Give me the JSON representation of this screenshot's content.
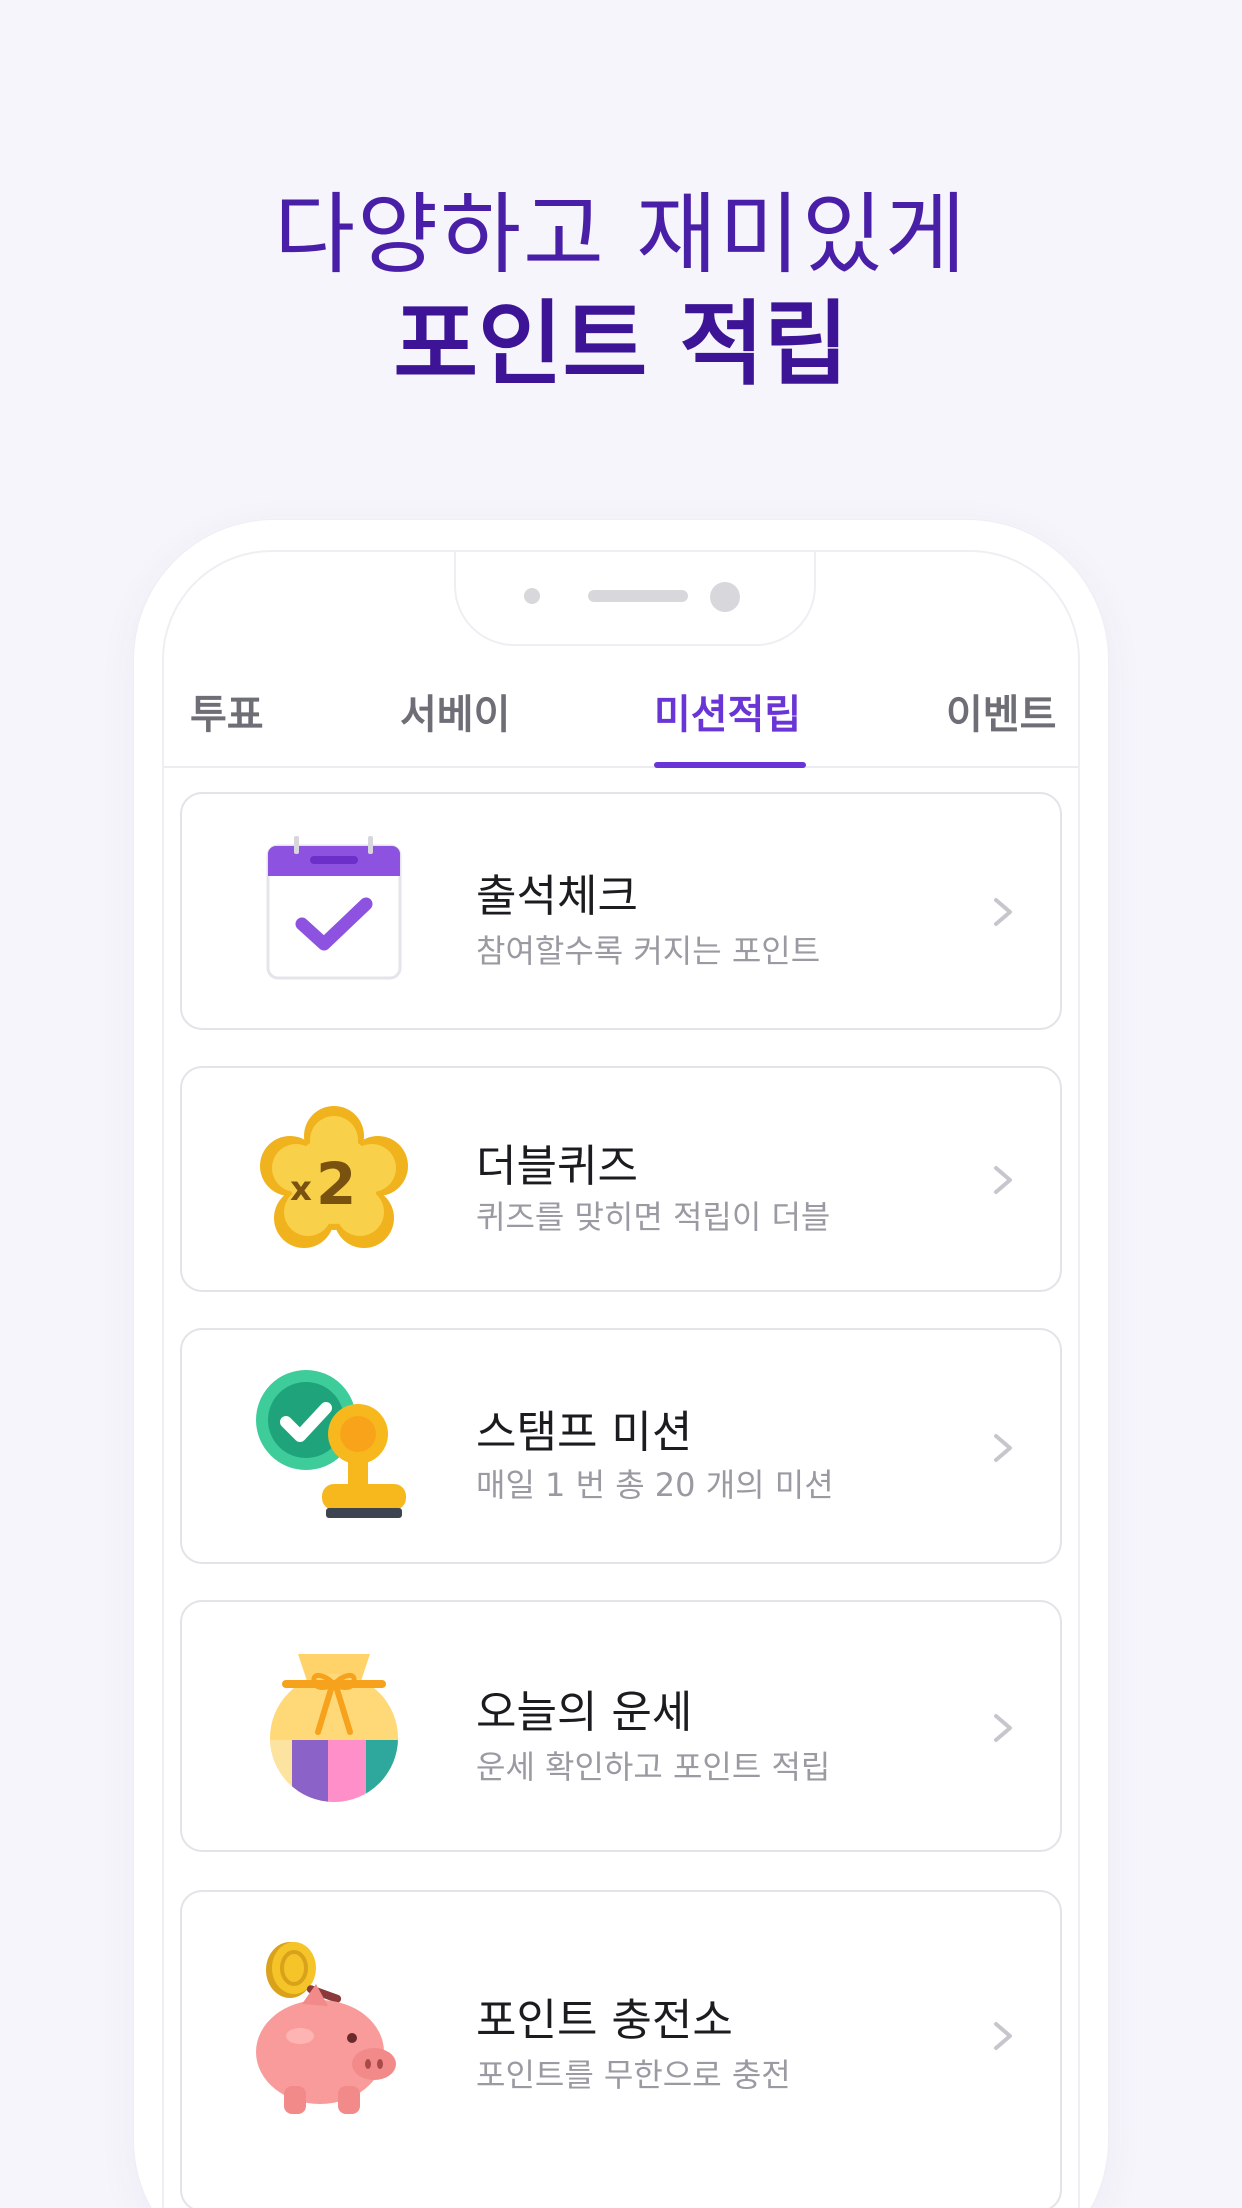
{
  "headline": {
    "line1": "다양하고 재미있게",
    "line2": "포인트 적립"
  },
  "tabs": [
    {
      "label": "투표"
    },
    {
      "label": "서베이"
    },
    {
      "label": "미션적립"
    },
    {
      "label": "이벤트"
    }
  ],
  "active_tab": "미션적립",
  "missions": [
    {
      "title": "출석체크",
      "subtitle": "참여할수록 커지는 포인트",
      "icon": "calendar-check-icon"
    },
    {
      "title": "더블퀴즈",
      "subtitle": "퀴즈를 맞히면 적립이 더블",
      "icon": "gold-x2-badge-icon"
    },
    {
      "title": "스탬프 미션",
      "subtitle": "매일 1 번 총 20 개의 미션",
      "icon": "stamp-check-icon"
    },
    {
      "title": "오늘의 운세",
      "subtitle": "운세 확인하고 포인트 적립",
      "icon": "lucky-bag-icon"
    },
    {
      "title": "포인트 충전소",
      "subtitle": "포인트를 무한으로 충전",
      "icon": "piggy-bank-icon"
    }
  ],
  "colors": {
    "accent": "#6a35d6",
    "headline": "#4a1fa8"
  }
}
